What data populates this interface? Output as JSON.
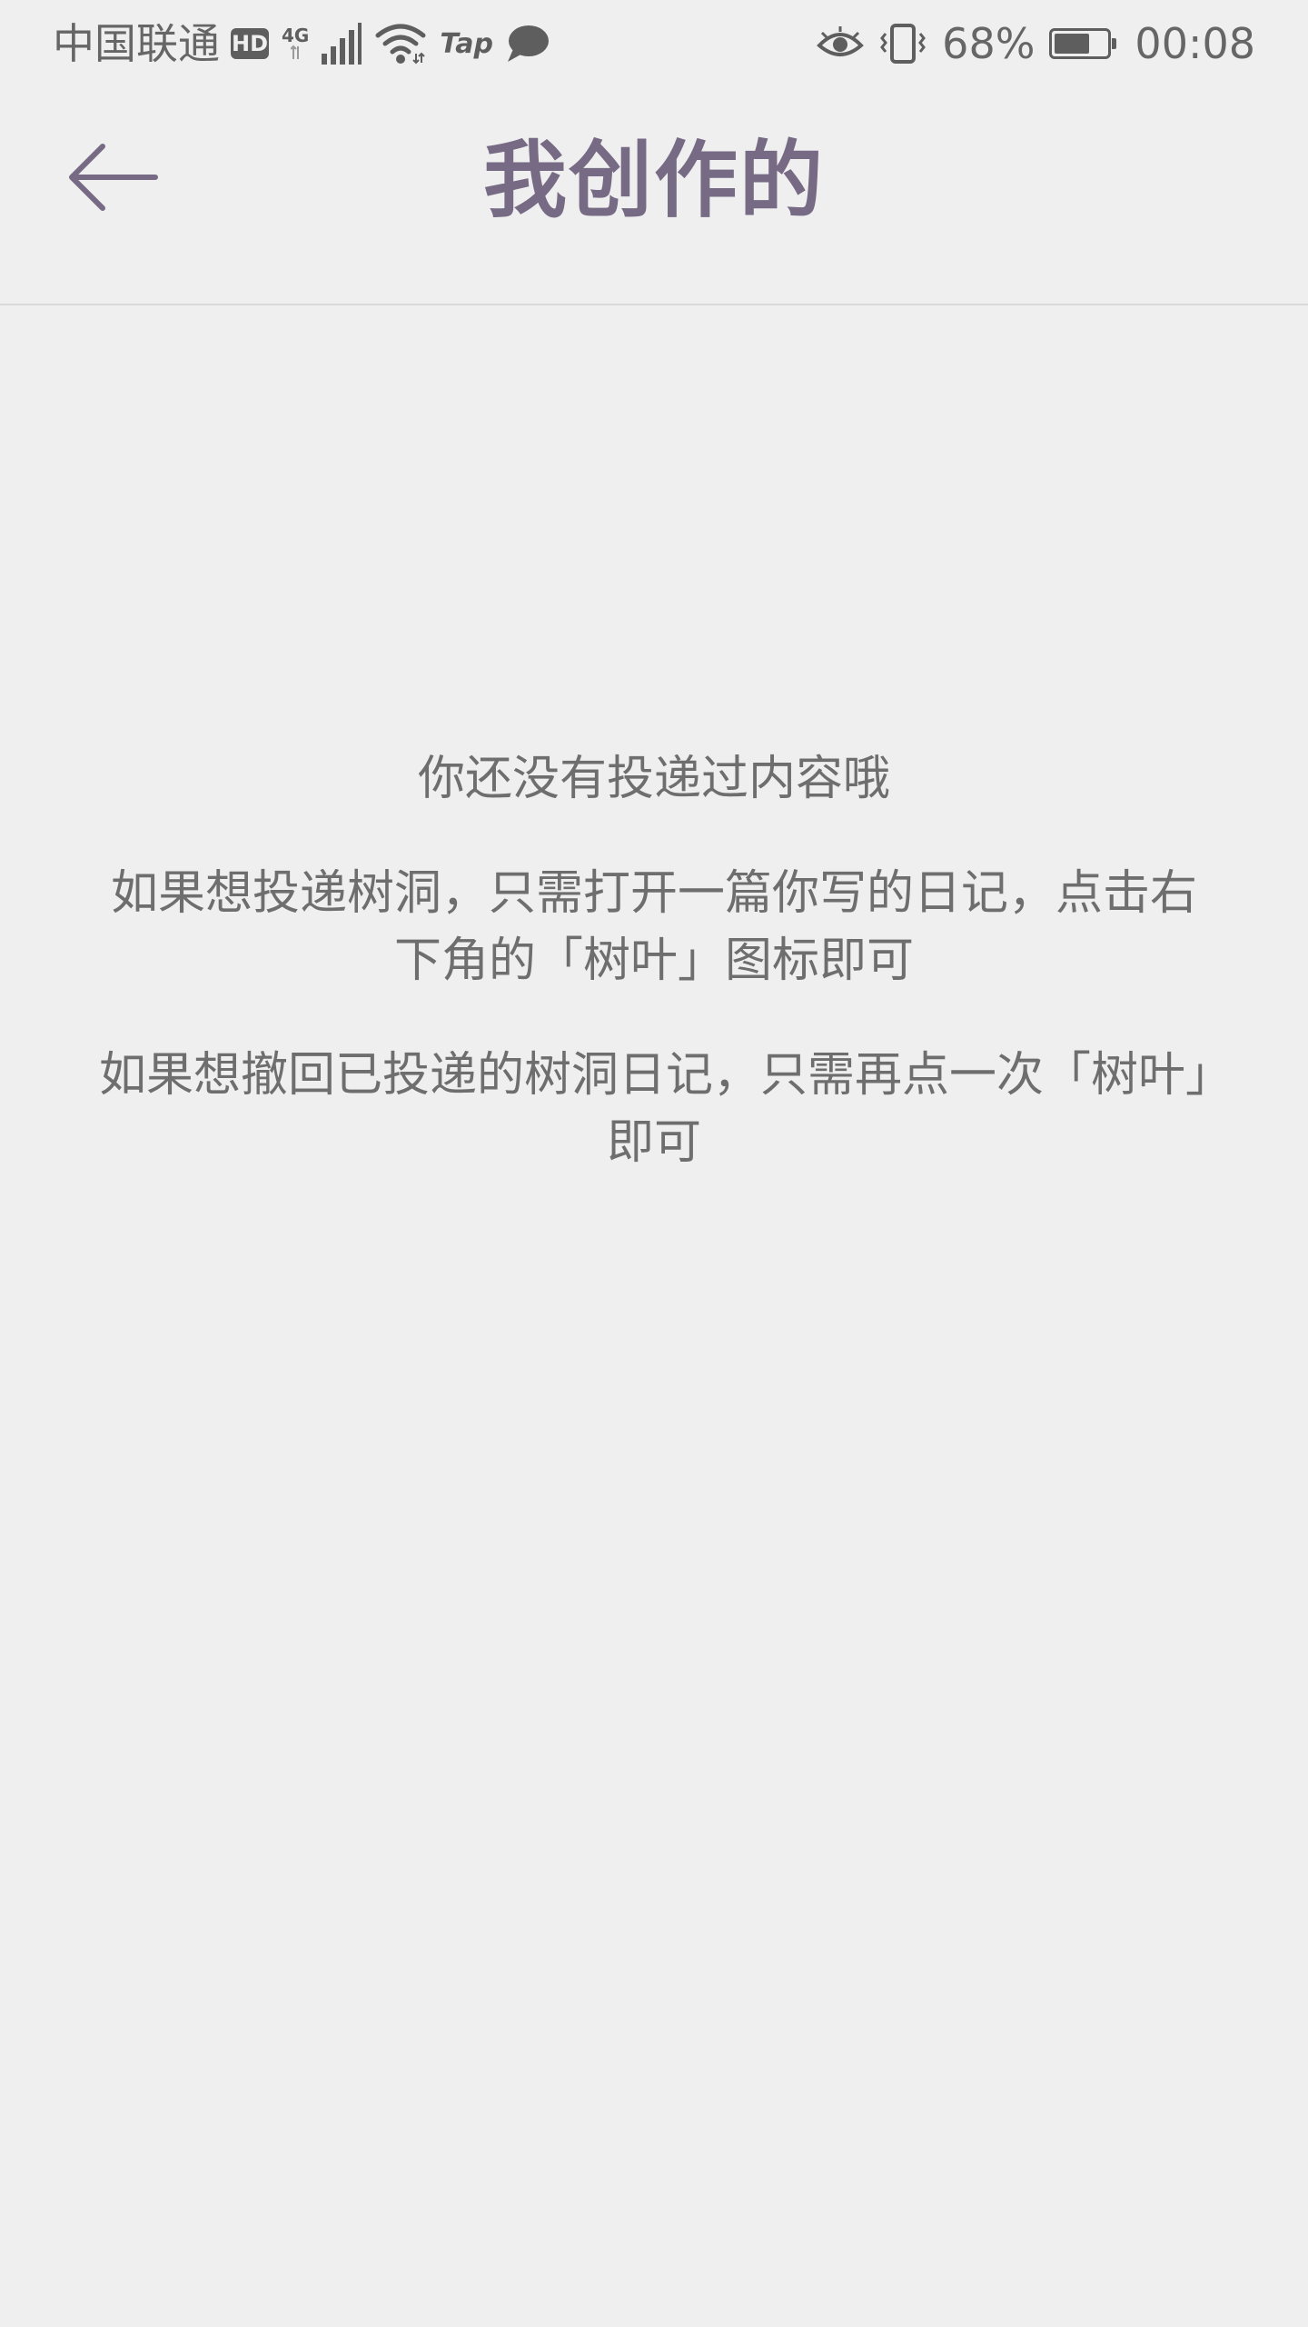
{
  "status_bar": {
    "carrier": "中国联通",
    "hd_badge": "HD",
    "network_type": "4G",
    "tap_label": "Tap",
    "battery_percent": "68%",
    "battery_level": 0.68,
    "time": "00:08"
  },
  "header": {
    "title": "我创作的"
  },
  "empty_state": {
    "message_1": "你还没有投递过内容哦",
    "message_2": "如果想投递树洞，只需打开一篇你写的日记，点击右下角的「树叶」图标即可",
    "message_3": "如果想撤回已投递的树洞日记，只需再点一次「树叶」即可"
  },
  "colors": {
    "background": "#efefef",
    "accent": "#766a84",
    "text": "#6e6e6e",
    "divider": "#d9d9d9"
  },
  "icons": {
    "back": "arrow-left-icon",
    "signal": "signal-icon",
    "wifi": "wifi-icon",
    "message": "chat-bubble-icon",
    "eye": "eye-icon",
    "vibrate": "vibrate-icon",
    "battery": "battery-icon"
  }
}
